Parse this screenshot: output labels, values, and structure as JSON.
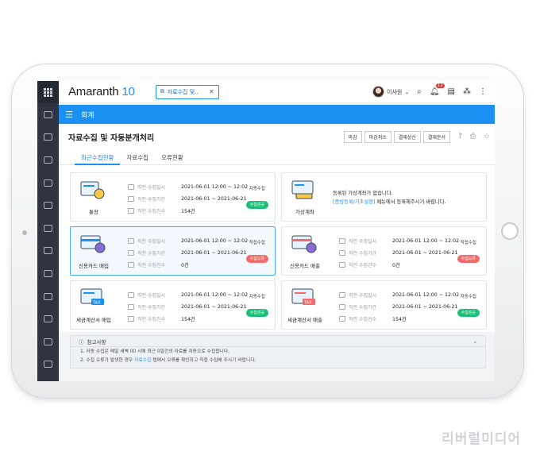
{
  "topbar": {
    "logo_text": "Amaranth",
    "logo_num": "10",
    "open_tab": "자료수집 및..",
    "user_name": "이사원",
    "notif_count": "12"
  },
  "menubar": {
    "title": "회계"
  },
  "page": {
    "title": "자료수집 및 자동분개처리",
    "buttons": [
      "마감",
      "마감취소",
      "결재상신",
      "결재문서"
    ]
  },
  "tabs": [
    "최근수집현황",
    "자료수집",
    "오류현황"
  ],
  "fields": {
    "date": "직전 수집일시",
    "period": "직전 수집기간",
    "count": "직전 수집건수"
  },
  "cards": {
    "bank": {
      "name": "통장",
      "date": "2021-06-01  12:00 ~ 12:02",
      "period": "2021-06-01 ~ 2021-06-21",
      "count": "154건",
      "status_label": "자동수집",
      "status": "수집성공"
    },
    "virtual": {
      "name": "가상계좌",
      "line1": "등록된 가상계좌가 없습니다.",
      "link": "[증빙등록/기초설정]",
      "line2": " 메뉴에서 등록해주시기 바랍니다."
    },
    "card_buy": {
      "name": "신용카드 매입",
      "date": "2021-06-01  12:00 ~ 12:02",
      "period": "2021-06-01 ~ 2021-06-21",
      "count": "0건",
      "status_label": "직접수집",
      "status": "수집오류"
    },
    "card_sell": {
      "name": "신용카드 매출",
      "date": "2021-06-01  12:00 ~ 12:02",
      "period": "2021-06-01 ~ 2021-06-21",
      "count": "0건",
      "status_label": "직접수집",
      "status": "수집오류"
    },
    "tax_buy": {
      "name": "세금계산서 매입",
      "date": "2021-06-01  12:00 ~ 12:02",
      "period": "2021-06-01 ~ 2021-06-21",
      "count": "154건",
      "status_label": "자동수집",
      "status": "수집성공"
    },
    "tax_sell": {
      "name": "세금계산서 매출",
      "date": "2021-06-01  12:00 ~ 12:02",
      "period": "2021-06-01 ~ 2021-06-21",
      "count": "154건",
      "status_label": "자동수집",
      "status": "수집성공"
    }
  },
  "notice": {
    "title": "참고사항",
    "line1": "1. 자동 수집은 매일 새벽 00 시에 최근 0일간의 자료를 자동으로 수집합니다.",
    "line2a": "2. 수집 오류가 발생한 경우 ",
    "line2link": "자료수집",
    "line2b": " 탭에서 오류를 확인하고 직접 수집해 주시기 바랍니다."
  },
  "watermark": "리버럴미디어",
  "colors": {
    "accent": "#1c90f3",
    "success": "#1ebd7a",
    "error": "#f26b6b",
    "sidebar": "#2f3440"
  }
}
